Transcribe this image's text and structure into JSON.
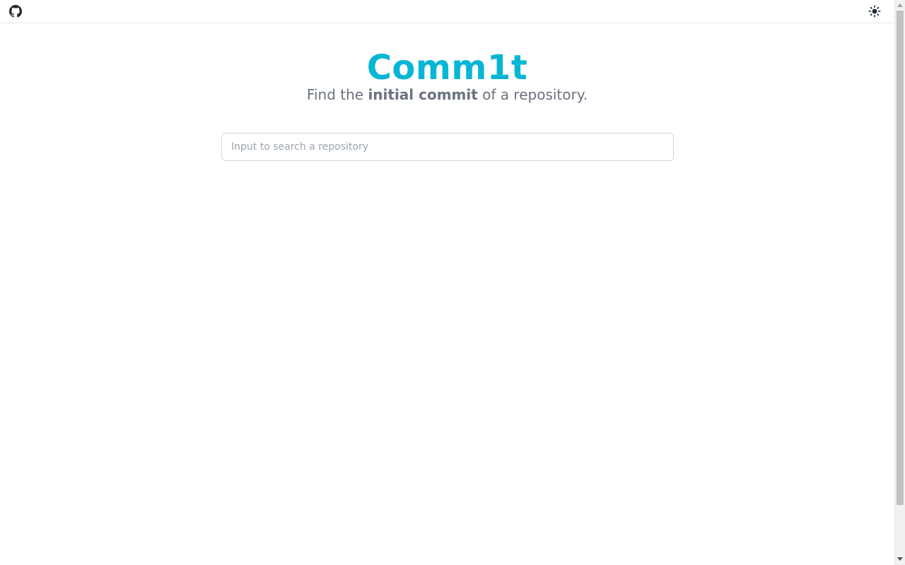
{
  "header": {
    "github_icon": "github-icon",
    "theme_icon": "sun-icon"
  },
  "hero": {
    "title": "Comm1t",
    "tagline_prefix": "Find the ",
    "tagline_bold": "initial commit",
    "tagline_suffix": " of a repository."
  },
  "search": {
    "placeholder": "Input to search a repository",
    "value": ""
  },
  "colors": {
    "brand": "#06b6d4",
    "text_muted": "#6b7280",
    "border": "#d1d5db"
  }
}
